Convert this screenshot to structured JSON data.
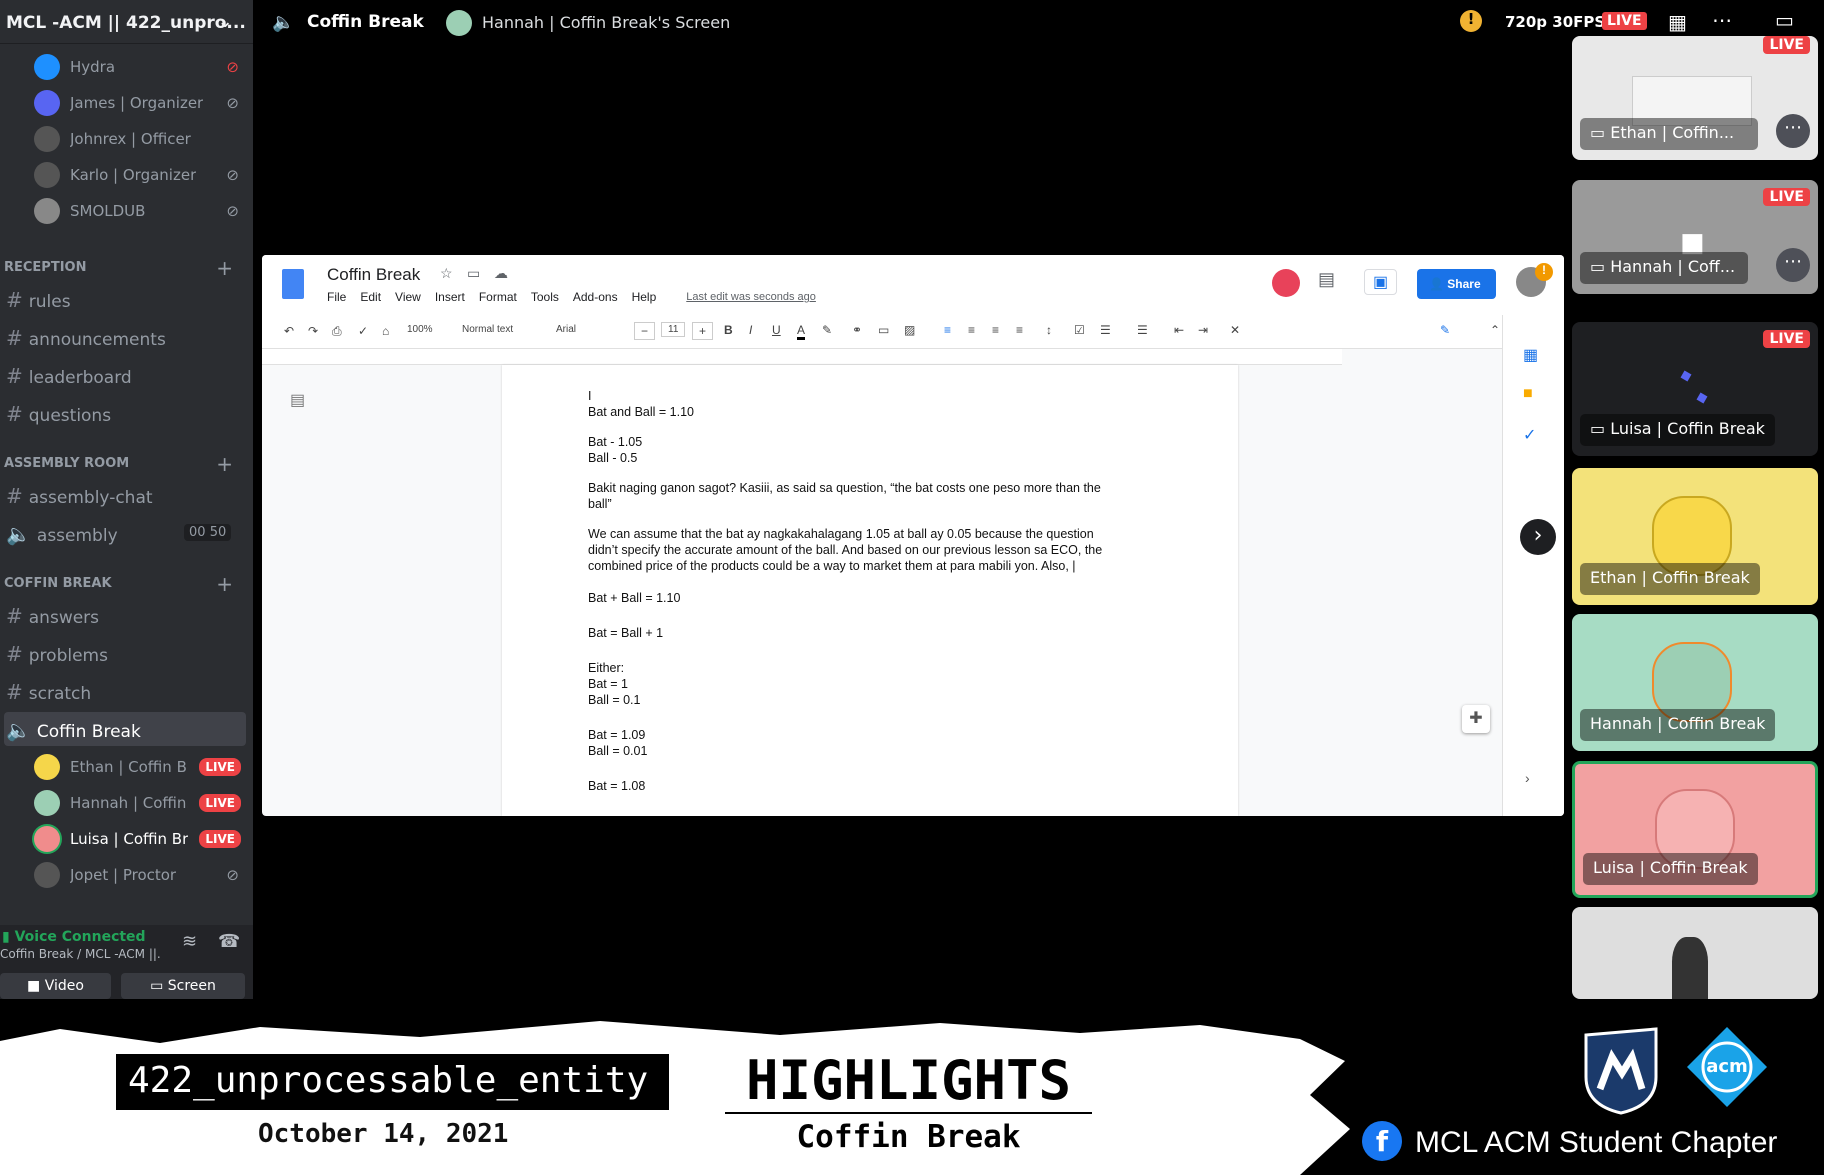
{
  "discord": {
    "server_name": "MCL -ACM || 422_unpro...",
    "top_users": [
      {
        "name": "Hydra",
        "icon": "deafened-icon"
      },
      {
        "name": "James | Organizer",
        "icon": "muted-icon"
      },
      {
        "name": "Johnrex | Officer",
        "icon": ""
      },
      {
        "name": "Karlo | Organizer",
        "icon": "muted-icon"
      },
      {
        "name": "SMOLDUB",
        "icon": "muted-icon"
      }
    ],
    "categories": {
      "reception": "RECEPTION",
      "assembly": "ASSEMBLY ROOM",
      "coffin": "COFFIN BREAK"
    },
    "reception_channels": [
      "rules",
      "announcements",
      "leaderboard",
      "questions"
    ],
    "assembly_channels": {
      "chat": "assembly-chat",
      "voice": "assembly",
      "count_a": "00",
      "count_b": "50"
    },
    "coffin_channels": [
      "answers",
      "problems",
      "scratch"
    ],
    "voice_channel": "Coffin Break",
    "voice_users": [
      {
        "name": "Ethan | Coffin B...",
        "live": "LIVE"
      },
      {
        "name": "Hannah | Coffin...",
        "live": "LIVE"
      },
      {
        "name": "Luisa | Coffin Br...",
        "live": "LIVE"
      },
      {
        "name": "Jopet | Proctor",
        "live": ""
      }
    ],
    "voice_status": "Voice Connected",
    "voice_location": "Coffin Break / MCL -ACM ||...",
    "video_btn": "Video",
    "screen_btn": "Screen"
  },
  "stream_header": {
    "channel": "Coffin Break",
    "screen_title": "Hannah | Coffin Break's Screen",
    "quality": "720p 30FPS",
    "live": "LIVE"
  },
  "participants": [
    {
      "label": "Ethan | Coffin...",
      "live": "LIVE"
    },
    {
      "label": "Hannah | Coff...",
      "live": "LIVE"
    },
    {
      "label": "Luisa | Coffin Break",
      "live": "LIVE"
    },
    {
      "label": "Ethan | Coffin Break",
      "live": ""
    },
    {
      "label": "Hannah | Coffin Break",
      "live": ""
    },
    {
      "label": "Luisa | Coffin Break",
      "live": ""
    }
  ],
  "gdoc": {
    "title": "Coffin Break",
    "menus": [
      "File",
      "Edit",
      "View",
      "Insert",
      "Format",
      "Tools",
      "Add-ons",
      "Help"
    ],
    "last_edit": "Last edit was seconds ago",
    "share": "Share",
    "zoom": "100%",
    "style": "Normal text",
    "font": "Arial",
    "size": "11",
    "lines": [
      "I",
      "Bat and Ball = 1.10",
      "Bat - 1.05",
      "Ball - 0.5",
      "Bakit naging ganon sagot? Kasiii, as said sa question, “the bat costs one peso more than the",
      "ball”",
      "We can assume that the bat ay nagkakahalagang 1.05 at ball ay 0.05 because the question",
      "didn’t specify the accurate amount of the ball. And based on our previous lesson sa ECO, the",
      "combined price of the products could be a way to market them at para mabili yon. Also, |",
      "Bat + Ball = 1.10",
      "Bat = Ball + 1",
      "Either:",
      "Bat = 1",
      "Ball = 0.1",
      "Bat = 1.09",
      "Ball = 0.01",
      "Bat = 1.08"
    ]
  },
  "banner": {
    "team": "422_unprocessable_entity",
    "date": "October 14, 2021",
    "heading": "HIGHLIGHTS",
    "subheading": "Coffin Break",
    "org": "MCL ACM Student Chapter",
    "acm": "acm"
  }
}
